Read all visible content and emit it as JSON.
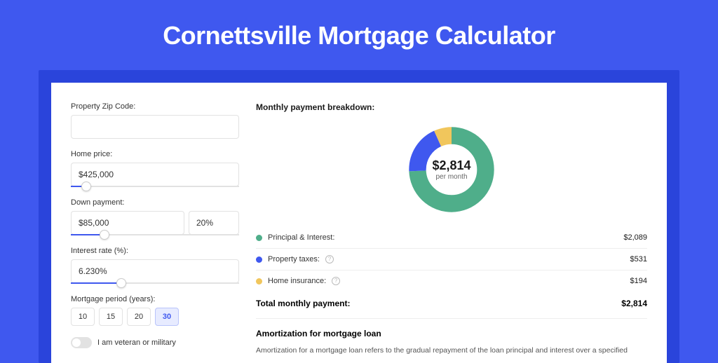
{
  "title": "Cornettsville Mortgage Calculator",
  "form": {
    "zip_label": "Property Zip Code:",
    "zip_value": "",
    "home_price_label": "Home price:",
    "home_price_value": "$425,000",
    "home_price_slider_pct": 9,
    "down_payment_label": "Down payment:",
    "down_payment_amount": "$85,000",
    "down_payment_pct": "20%",
    "down_payment_slider_pct": 20,
    "interest_label": "Interest rate (%):",
    "interest_value": "6.230%",
    "interest_slider_pct": 30,
    "period_label": "Mortgage period (years):",
    "periods": [
      "10",
      "15",
      "20",
      "30"
    ],
    "period_selected": "30",
    "veteran_label": "I am veteran or military"
  },
  "breakdown": {
    "heading": "Monthly payment breakdown:",
    "total_amount": "$2,814",
    "per_month": "per month",
    "items": [
      {
        "label": "Principal & Interest:",
        "value": "$2,089",
        "color": "#4fae8a",
        "has_info": false
      },
      {
        "label": "Property taxes:",
        "value": "$531",
        "color": "#3f58ef",
        "has_info": true
      },
      {
        "label": "Home insurance:",
        "value": "$194",
        "color": "#f1c65c",
        "has_info": true
      }
    ],
    "total_label": "Total monthly payment:",
    "total_value": "$2,814"
  },
  "chart_data": {
    "type": "pie",
    "title": "Monthly payment breakdown",
    "series": [
      {
        "name": "Principal & Interest",
        "value": 2089,
        "color": "#4fae8a"
      },
      {
        "name": "Property taxes",
        "value": 531,
        "color": "#3f58ef"
      },
      {
        "name": "Home insurance",
        "value": 194,
        "color": "#f1c65c"
      }
    ],
    "center_label": "$2,814",
    "center_sub": "per month"
  },
  "amortization": {
    "heading": "Amortization for mortgage loan",
    "text": "Amortization for a mortgage loan refers to the gradual repayment of the loan principal and interest over a specified"
  }
}
